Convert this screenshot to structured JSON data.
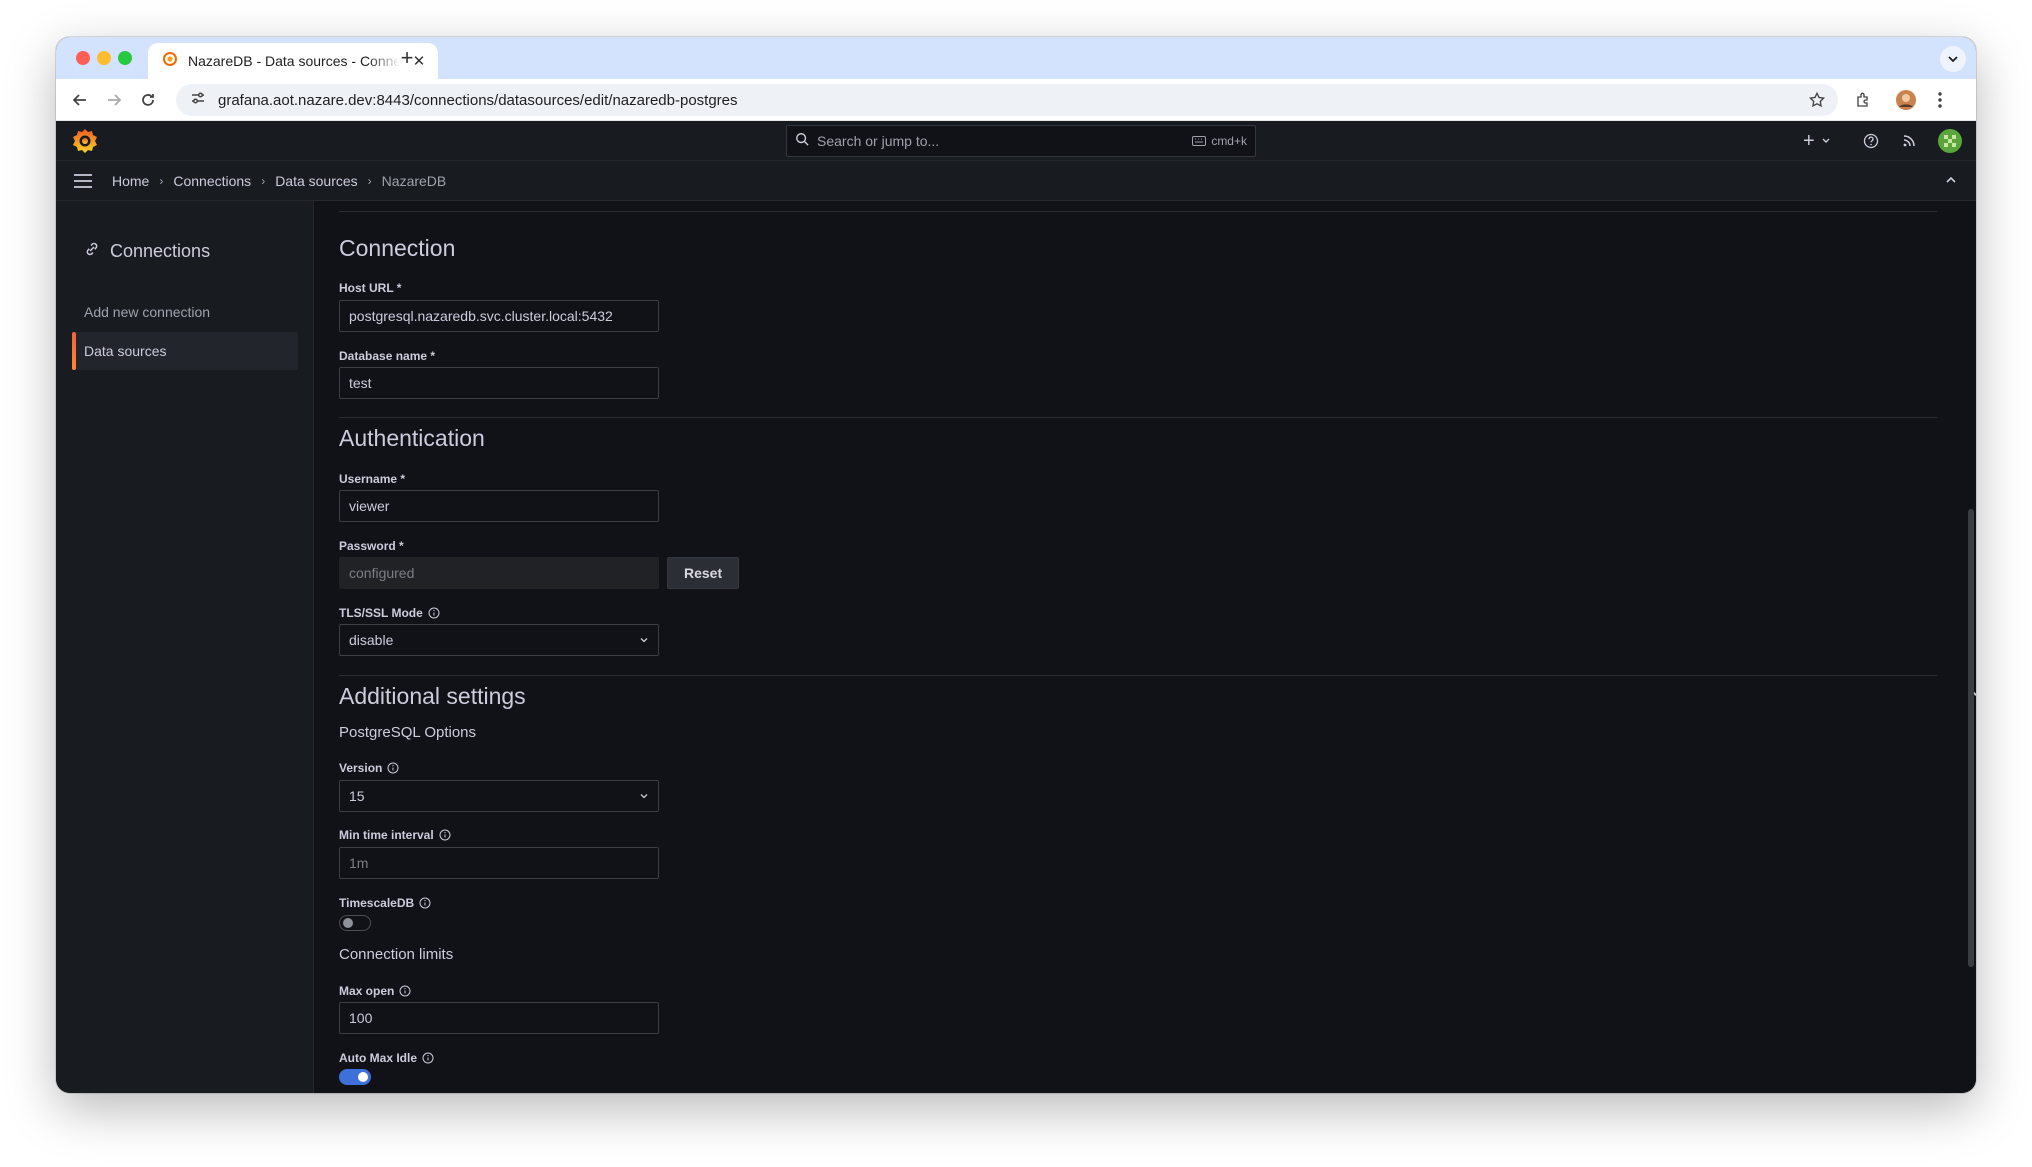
{
  "browser": {
    "tab_title": "NazareDB - Data sources - Connections",
    "new_tab": "+",
    "url": "grafana.aot.nazare.dev:8443/connections/datasources/edit/nazaredb-postgres"
  },
  "header": {
    "search_placeholder": "Search or jump to...",
    "search_shortcut": "cmd+k",
    "add_label": "+"
  },
  "breadcrumb": {
    "items": [
      "Home",
      "Connections",
      "Data sources",
      "NazareDB"
    ],
    "separator": "›"
  },
  "sidebar": {
    "title": "Connections",
    "items": [
      {
        "label": "Add new connection",
        "active": false
      },
      {
        "label": "Data sources",
        "active": true
      }
    ]
  },
  "connection": {
    "heading": "Connection",
    "host_label": "Host URL *",
    "host_value": "postgresql.nazaredb.svc.cluster.local:5432",
    "db_label": "Database name *",
    "db_value": "test"
  },
  "authentication": {
    "heading": "Authentication",
    "username_label": "Username *",
    "username_value": "viewer",
    "password_label": "Password *",
    "password_placeholder": "configured",
    "reset_label": "Reset",
    "tls_label": "TLS/SSL Mode",
    "tls_value": "disable"
  },
  "additional": {
    "heading": "Additional settings",
    "pg_options": "PostgreSQL Options",
    "version_label": "Version",
    "version_value": "15",
    "min_interval_label": "Min time interval",
    "min_interval_placeholder": "1m",
    "timescale_label": "TimescaleDB",
    "timescale_on": false,
    "limits_heading": "Connection limits",
    "max_open_label": "Max open",
    "max_open_value": "100",
    "auto_max_idle_label": "Auto Max Idle",
    "auto_max_idle_on": true
  },
  "colors": {
    "accent": "#3d71d9",
    "brand": "#f55f3e",
    "background": "#111217",
    "panel": "#181b1f"
  }
}
